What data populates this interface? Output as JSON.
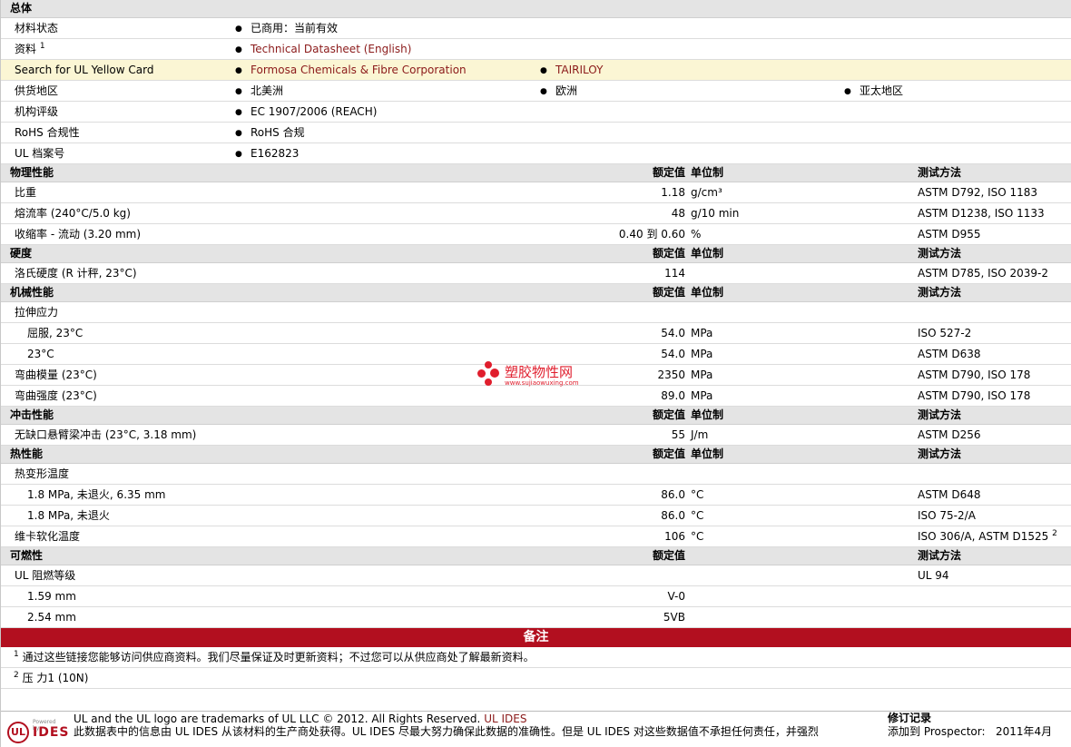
{
  "overview": {
    "header": "总体",
    "rows": [
      {
        "label": "材料状态",
        "items": [
          "已商用：当前有效"
        ],
        "links": false
      },
      {
        "label": "资料",
        "sup": "1",
        "items": [
          "Technical Datasheet (English)"
        ],
        "links": true
      },
      {
        "label": "Search for UL Yellow Card",
        "items": [
          "Formosa Chemicals & Fibre Corporation",
          "TAIRILOY"
        ],
        "links": true,
        "highlight": true
      },
      {
        "label": "供货地区",
        "items": [
          "北美洲",
          "欧洲",
          "亚太地区"
        ],
        "links": false
      },
      {
        "label": "机构评级",
        "items": [
          "EC 1907/2006 (REACH)"
        ],
        "links": false
      },
      {
        "label": "RoHS 合规性",
        "items": [
          "RoHS 合规"
        ],
        "links": false
      },
      {
        "label": "UL 档案号",
        "items": [
          "E162823"
        ],
        "links": false
      }
    ]
  },
  "sections": [
    {
      "title": "物理性能",
      "col_value": "额定值",
      "col_unit": "单位制",
      "col_test": "测试方法",
      "rows": [
        {
          "label": "比重",
          "value": "1.18",
          "unit": "g/cm³",
          "test": "ASTM D792, ISO 1183"
        },
        {
          "label": "熔流率 (240°C/5.0 kg)",
          "value": "48",
          "unit": "g/10 min",
          "test": "ASTM D1238, ISO 1133"
        },
        {
          "label": "收缩率 - 流动 (3.20 mm)",
          "value": "0.40 到 0.60",
          "unit": "%",
          "test": "ASTM D955"
        }
      ]
    },
    {
      "title": "硬度",
      "col_value": "额定值",
      "col_unit": "单位制",
      "col_test": "测试方法",
      "rows": [
        {
          "label": "洛氏硬度 (R 计秤, 23°C)",
          "value": "114",
          "unit": "",
          "test": "ASTM D785, ISO 2039-2"
        }
      ]
    },
    {
      "title": "机械性能",
      "col_value": "额定值",
      "col_unit": "单位制",
      "col_test": "测试方法",
      "rows": [
        {
          "label": "拉伸应力",
          "value": "",
          "unit": "",
          "test": ""
        },
        {
          "label": "屈服, 23°C",
          "value": "54.0",
          "unit": "MPa",
          "test": "ISO 527-2",
          "indent": true
        },
        {
          "label": "23°C",
          "value": "54.0",
          "unit": "MPa",
          "test": "ASTM D638",
          "indent": true
        },
        {
          "label": "弯曲模量 (23°C)",
          "value": "2350",
          "unit": "MPa",
          "test": "ASTM D790, ISO 178"
        },
        {
          "label": "弯曲强度 (23°C)",
          "value": "89.0",
          "unit": "MPa",
          "test": "ASTM D790, ISO 178"
        }
      ]
    },
    {
      "title": "冲击性能",
      "col_value": "额定值",
      "col_unit": "单位制",
      "col_test": "测试方法",
      "rows": [
        {
          "label": "无缺口悬臂梁冲击 (23°C, 3.18 mm)",
          "value": "55",
          "unit": "J/m",
          "test": "ASTM D256"
        }
      ]
    },
    {
      "title": "热性能",
      "col_value": "额定值",
      "col_unit": "单位制",
      "col_test": "测试方法",
      "rows": [
        {
          "label": "热变形温度",
          "value": "",
          "unit": "",
          "test": ""
        },
        {
          "label": "1.8 MPa, 未退火, 6.35 mm",
          "value": "86.0",
          "unit": "°C",
          "test": "ASTM D648",
          "indent": true
        },
        {
          "label": "1.8 MPa, 未退火",
          "value": "86.0",
          "unit": "°C",
          "test": "ISO 75-2/A",
          "indent": true
        },
        {
          "label": "维卡软化温度",
          "value": "106",
          "unit": "°C",
          "test": "ISO 306/A, ASTM D1525",
          "test_sup": "2"
        }
      ]
    },
    {
      "title": "可燃性",
      "col_value": "额定值",
      "col_unit": "",
      "col_test": "测试方法",
      "rows": [
        {
          "label": "UL 阻燃等级",
          "value": "",
          "unit": "",
          "test": "UL 94"
        },
        {
          "label": "1.59 mm",
          "value": "V-0",
          "unit": "",
          "test": "",
          "indent": true
        },
        {
          "label": "2.54 mm",
          "value": "5VB",
          "unit": "",
          "test": "",
          "indent": true
        }
      ]
    }
  ],
  "notes": {
    "title": "备注",
    "items": [
      {
        "num": "1",
        "text": "通过这些链接您能够访问供应商资料。我们尽量保证及时更新资料；不过您可以从供应商处了解最新资料。"
      },
      {
        "num": "2",
        "text": "压 力1 (10N)"
      }
    ]
  },
  "footer": {
    "logo_ul": "UL",
    "logo_powered": "Powered by",
    "logo_ides": "IDES",
    "line1": "UL and the UL logo are trademarks of UL LLC © 2012. All Rights Reserved.",
    "line1_link": "UL IDES",
    "line2": "此数据表中的信息由  UL IDES 从该材料的生产商处获得。UL IDES 尽最大努力确保此数据的准确性。但是  UL IDES 对这些数据值不承担任何责任，并强烈",
    "revision_title": "修订记录",
    "revision_label": "添加到  Prospector:",
    "revision_date": "2011年4月"
  },
  "watermark": {
    "text": "塑胶物性网",
    "url": "www.sujiaowuxing.com"
  },
  "colors": {
    "link": "#8b1a1a",
    "notes_bar": "#b20f1f",
    "highlight_row": "#fbf6d4",
    "header_row": "#e4e4e4"
  }
}
